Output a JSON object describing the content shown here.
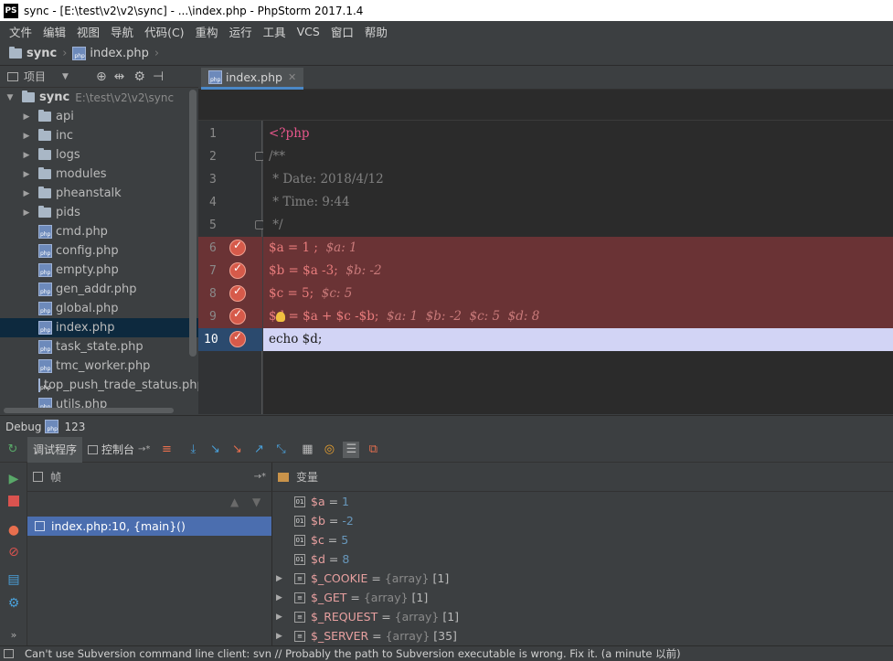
{
  "window": {
    "title": "sync - [E:\\test\\v2\\v2\\sync] - ...\\index.php - PhpStorm 2017.1.4",
    "logo": "PS"
  },
  "menu": [
    "文件",
    "编辑",
    "视图",
    "导航",
    "代码(C)",
    "重构",
    "运行",
    "工具",
    "VCS",
    "窗口",
    "帮助"
  ],
  "breadcrumb": {
    "project": "sync",
    "file": "index.php"
  },
  "project_panel": {
    "title": "项目",
    "root": {
      "name": "sync",
      "path": "E:\\test\\v2\\v2\\sync"
    },
    "folders": [
      "api",
      "inc",
      "logs",
      "modules",
      "pheanstalk",
      "pids"
    ],
    "files": [
      "cmd.php",
      "config.php",
      "empty.php",
      "gen_addr.php",
      "global.php",
      "index.php",
      "task_state.php",
      "tmc_worker.php",
      "top_push_trade_status.php",
      "utils.php"
    ],
    "selected": "index.php"
  },
  "editor": {
    "tab": "index.php",
    "line_numbers": [
      "1",
      "2",
      "3",
      "4",
      "5",
      "6",
      "7",
      "8",
      "9",
      "10"
    ],
    "lines": {
      "l1": "<?php",
      "l2": "/**",
      "l3": " * Date: 2018/4/12",
      "l4": " * Time: 9:44",
      "l5": " */",
      "l6_code": "$a = 1 ;",
      "l6_inline": "$a: 1",
      "l7_code": "$b = $a -3;",
      "l7_inline": "$b: -2",
      "l8_code": "$c = 5;",
      "l8_inline": "$c: 5",
      "l9_code": "$d = $a + $c -$b;",
      "l9_inline": "$a: 1  $b: -2  $c: 5  $d: 8",
      "l10": "echo $d;"
    }
  },
  "debug": {
    "label": "Debug",
    "session": "123",
    "tabs": {
      "debugger": "调试程序",
      "console": "控制台"
    },
    "frames_title": "帧",
    "frame_selected": "index.php:10, {main}()",
    "variables_title": "变量",
    "variables": [
      {
        "name": "$a",
        "eq": " = ",
        "value": "1",
        "type": "",
        "expandable": false
      },
      {
        "name": "$b",
        "eq": " = ",
        "value": "-2",
        "type": "",
        "expandable": false
      },
      {
        "name": "$c",
        "eq": " = ",
        "value": "5",
        "type": "",
        "expandable": false
      },
      {
        "name": "$d",
        "eq": " = ",
        "value": "8",
        "type": "",
        "expandable": false
      },
      {
        "name": "$_COOKIE",
        "eq": " = ",
        "value": "[1]",
        "type": "{array}",
        "expandable": true
      },
      {
        "name": "$_GET",
        "eq": " = ",
        "value": "[1]",
        "type": "{array}",
        "expandable": true
      },
      {
        "name": "$_REQUEST",
        "eq": " = ",
        "value": "[1]",
        "type": "{array}",
        "expandable": true
      },
      {
        "name": "$_SERVER",
        "eq": " = ",
        "value": "[35]",
        "type": "{array}",
        "expandable": true
      }
    ]
  },
  "status": "Can't use Subversion command line client: svn // Probably the path to Subversion executable is wrong. Fix it. (a minute 以前)"
}
